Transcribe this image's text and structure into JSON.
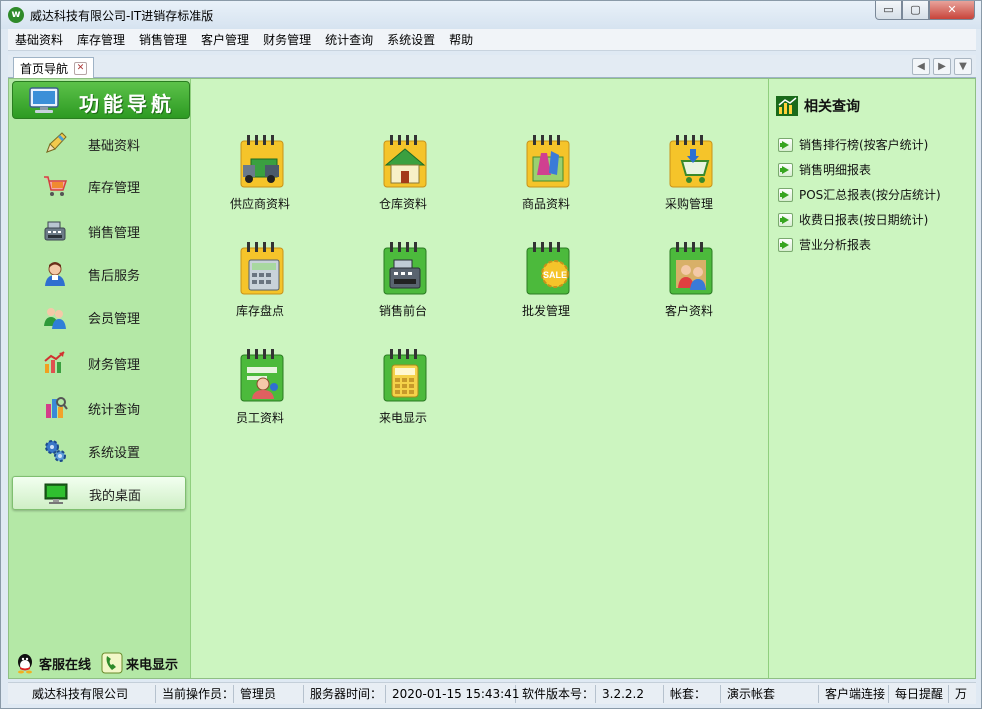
{
  "window": {
    "title": "威达科技有限公司-IT进销存标准版",
    "app_icon": "w-logo-icon",
    "minimize": "▭",
    "maximize": "▢",
    "close": "✕"
  },
  "menubar": {
    "items": [
      "基础资料",
      "库存管理",
      "销售管理",
      "客户管理",
      "财务管理",
      "统计查询",
      "系统设置",
      "帮助"
    ]
  },
  "tabs": {
    "items": [
      {
        "label": "首页导航",
        "close": "✕"
      }
    ],
    "nav": [
      "◀",
      "▶",
      "▼"
    ]
  },
  "leftnav": {
    "title": "功能导航",
    "items": [
      {
        "label": "基础资料",
        "icon": "pencil-icon"
      },
      {
        "label": "库存管理",
        "icon": "cart-icon"
      },
      {
        "label": "销售管理",
        "icon": "cash-register-icon"
      },
      {
        "label": "售后服务",
        "icon": "service-person-icon"
      },
      {
        "label": "会员管理",
        "icon": "members-icon"
      },
      {
        "label": "财务管理",
        "icon": "finance-chart-icon"
      },
      {
        "label": "统计查询",
        "icon": "statistics-icon"
      },
      {
        "label": "系统设置",
        "icon": "gears-icon"
      },
      {
        "label": "我的桌面",
        "icon": "desktop-monitor-icon",
        "active": true
      }
    ],
    "support": [
      {
        "label": "客服在线",
        "icon": "qq-penguin-icon"
      },
      {
        "label": "来电显示",
        "icon": "phone-icon"
      }
    ]
  },
  "grid": {
    "items": [
      {
        "label": "供应商资料",
        "icon": "supplier-truck-icon"
      },
      {
        "label": "仓库资料",
        "icon": "warehouse-house-icon"
      },
      {
        "label": "商品资料",
        "icon": "goods-icon"
      },
      {
        "label": "采购管理",
        "icon": "purchase-cart-icon"
      },
      {
        "label": "库存盘点",
        "icon": "inventory-calculator-icon"
      },
      {
        "label": "销售前台",
        "icon": "sales-register-icon"
      },
      {
        "label": "批发管理",
        "icon": "wholesale-sale-icon"
      },
      {
        "label": "客户资料",
        "icon": "customer-people-icon"
      },
      {
        "label": "员工资料",
        "icon": "employee-icon"
      },
      {
        "label": "来电显示",
        "icon": "caller-id-phone-icon"
      }
    ]
  },
  "rightpanel": {
    "title": "相关查询",
    "items": [
      "销售排行榜(按客户统计)",
      "销售明细报表",
      "POS汇总报表(按分店统计)",
      "收费日报表(按日期统计)",
      "营业分析报表"
    ]
  },
  "statusbar": {
    "company": "威达科技有限公司",
    "operator_label": "当前操作员：",
    "operator": "管理员",
    "server_time_label": "服务器时间：",
    "server_time": "2020-01-15 15:43:41",
    "version_label": "软件版本号：",
    "version": "3.2.2.2",
    "account_label": "帐套：",
    "account": "演示帐套",
    "client_status": "客户端连接",
    "daily_reminder": "每日提醒",
    "extra": "万"
  },
  "colors": {
    "main_bg": "#ccf5c0",
    "nav_bg": "#b4e8a6",
    "header_green": "#2d9a22",
    "notepad_yellow": "#f5c42a",
    "notepad_green": "#4cba3c"
  }
}
